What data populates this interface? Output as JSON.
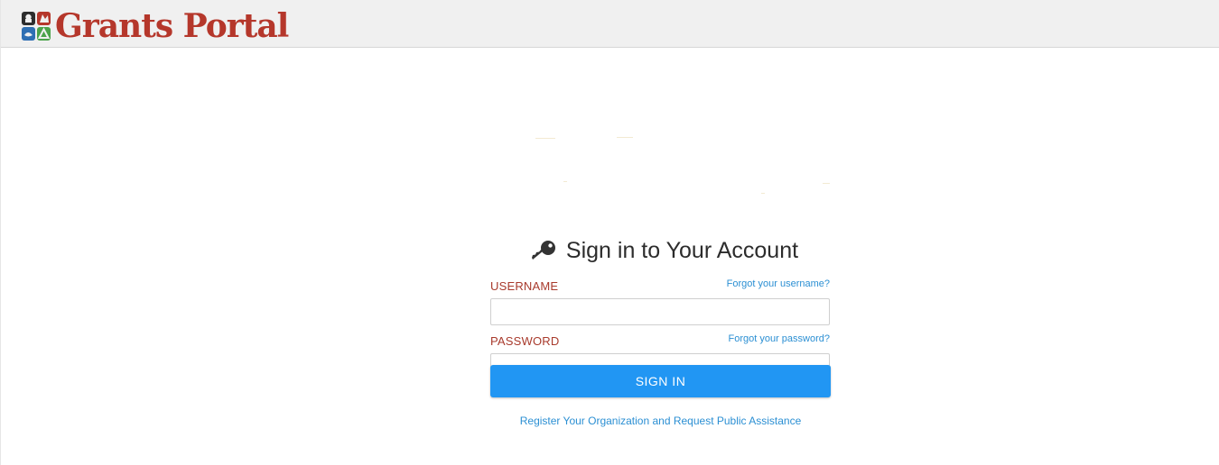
{
  "header": {
    "logo_text": "Grants Portal",
    "brand_color": "#b5372b"
  },
  "signin": {
    "title": "Sign in to Your Account",
    "title_icon": "key-icon",
    "username_label": "USERNAME",
    "forgot_username": "Forgot your username?",
    "username_value": "",
    "password_label": "PASSWORD",
    "forgot_password": "Forgot your password?",
    "password_value": "",
    "signin_button": "SIGN IN",
    "register_link": "Register Your Organization and Request Public Assistance",
    "button_color": "#2196f3",
    "label_color": "#a83a2c",
    "link_color": "#2b8fd3"
  }
}
